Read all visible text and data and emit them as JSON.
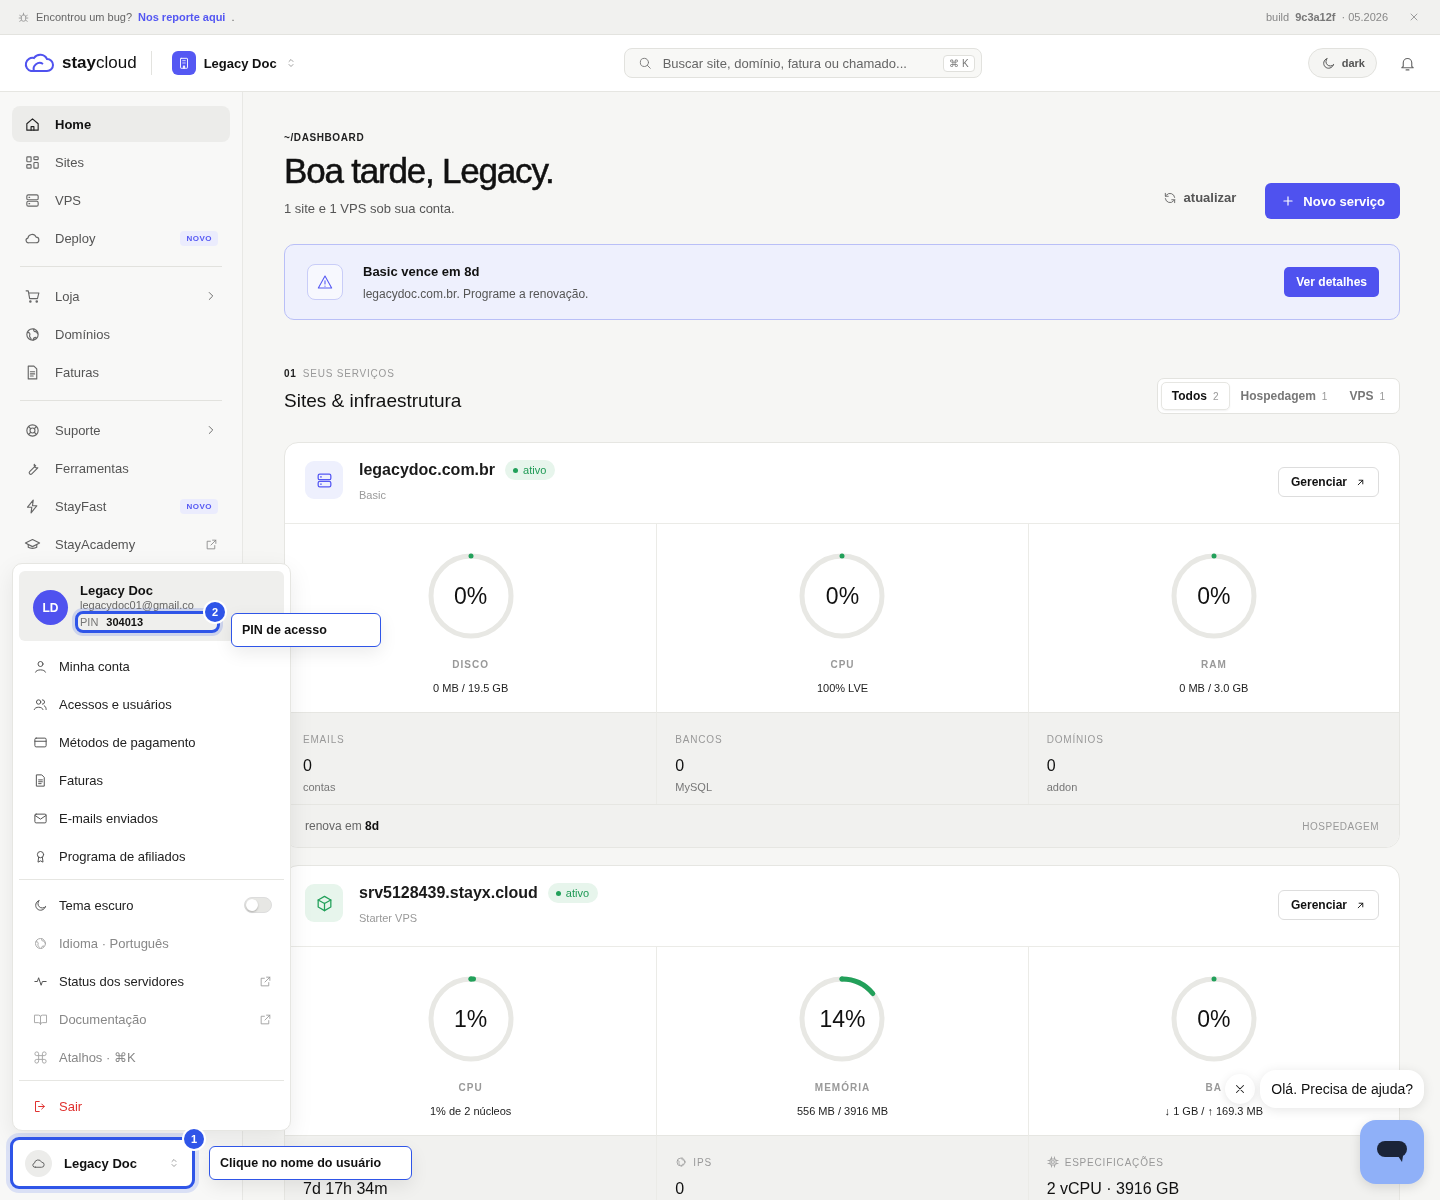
{
  "bug_bar": {
    "text": "Encontrou um bug?",
    "link": "Nos reporte aqui",
    "suffix": ".",
    "build_label": "build",
    "build_hash": "9c3a12f",
    "build_date": "· 05.2026"
  },
  "header": {
    "brand": "**stay**cloud",
    "workspace": "Legacy Doc",
    "search_placeholder": "Buscar site, domínio, fatura ou chamado...",
    "shortcut": "⌘ K",
    "theme_button": "dark"
  },
  "sidebar": {
    "groups": [
      [
        {
          "label": "Home",
          "selected": true,
          "kind": "link"
        },
        {
          "label": "Sites",
          "selected": false,
          "kind": "link"
        },
        {
          "label": "VPS",
          "selected": false,
          "kind": "link"
        },
        {
          "label": "Deploy",
          "selected": false,
          "kind": "link",
          "badge": "NOVO"
        }
      ],
      [
        {
          "label": "Loja",
          "selected": false,
          "kind": "submenu"
        },
        {
          "label": "Domínios",
          "selected": false,
          "kind": "link"
        },
        {
          "label": "Faturas",
          "selected": false,
          "kind": "link"
        }
      ],
      [
        {
          "label": "Suporte",
          "selected": false,
          "kind": "submenu"
        },
        {
          "label": "Ferramentas",
          "selected": false,
          "kind": "link"
        },
        {
          "label": "StayFast",
          "selected": false,
          "kind": "link",
          "badge": "NOVO"
        },
        {
          "label": "StayAcademy",
          "selected": false,
          "kind": "external"
        }
      ]
    ]
  },
  "page": {
    "breadcrumb": "~/DASHBOARD",
    "title": "Boa tarde, Legacy.",
    "subtitle": "1 site e 1 VPS sob sua conta.",
    "refresh": "atualizar",
    "new_button": "Novo serviço"
  },
  "alert": {
    "title": "Basic vence em 8d",
    "text": "legacydoc.com.br. Programe a renovação.",
    "button": "Ver detalhes"
  },
  "section": {
    "number": "01",
    "eyebrow": "SEUS SERVIÇOS",
    "title": "Sites & infraestrutura",
    "filters": [
      {
        "label": "Todos",
        "count": "2",
        "selected": true
      },
      {
        "label": "Hospedagem",
        "count": "1",
        "selected": false
      },
      {
        "label": "VPS",
        "count": "1",
        "selected": false
      }
    ]
  },
  "services": [
    {
      "kind": "hosting",
      "name": "legacydoc.com.br",
      "status": "ativo",
      "plan": "Basic",
      "manage": "Gerenciar",
      "gauges": [
        {
          "value": "0%",
          "label": "DISCO",
          "detail": "0 MB / 19.5 GB"
        },
        {
          "value": "0%",
          "label": "CPU",
          "detail": "100% LVE"
        },
        {
          "value": "0%",
          "label": "RAM",
          "detail": "0 MB / 3.0 GB"
        }
      ],
      "stats": [
        {
          "kind": "plain",
          "label": "EMAILS",
          "value": "0",
          "unit": "contas"
        },
        {
          "kind": "plain",
          "label": "BANCOS",
          "value": "0",
          "unit": "MySQL"
        },
        {
          "kind": "plain",
          "label": "DOMÍNIOS",
          "value": "0",
          "unit": "addon"
        }
      ],
      "footer": {
        "renew": "renova em **8d**",
        "type": "HOSPEDAGEM"
      }
    },
    {
      "kind": "vps",
      "name": "srv5128439.stayx.cloud",
      "status": "ativo",
      "plan": "Starter VPS",
      "manage": "Gerenciar",
      "gauges": [
        {
          "value": "1%",
          "label": "CPU",
          "detail": "1% de 2 núcleos"
        },
        {
          "value": "14%",
          "label": "MEMÓRIA",
          "detail": "556 MB / 3916 MB"
        },
        {
          "value": "0%",
          "label": "BA",
          "detail": "↓ 1 GB / ↑ 169.3 MB"
        }
      ],
      "stats": [
        {
          "kind": "plain",
          "value": "7d 17h 34m"
        },
        {
          "kind": "network",
          "label": "IPS",
          "value": "0"
        },
        {
          "kind": "chip",
          "label": "ESPECIFICAÇÕES",
          "value": "2 vCPU · 3916 GB"
        }
      ]
    }
  ],
  "user_menu": {
    "name": "Legacy Doc",
    "initials": "LD",
    "email": "legacydoc01@gmail.co",
    "pin_label": "PIN",
    "pin": "304013",
    "groups": [
      [
        {
          "label": "Minha conta",
          "kind": "link",
          "muted": false
        },
        {
          "label": "Acessos e usuários",
          "kind": "link",
          "muted": false
        },
        {
          "label": "Métodos de pagamento",
          "kind": "link",
          "muted": false
        },
        {
          "label": "Faturas",
          "kind": "link",
          "muted": false
        },
        {
          "label": "E-mails enviados",
          "kind": "link",
          "muted": false
        },
        {
          "label": "Programa de afiliados",
          "kind": "link",
          "muted": false
        }
      ],
      [
        {
          "label": "Tema escuro",
          "kind": "toggle",
          "on": false,
          "muted": false
        },
        {
          "label": "Idioma · Português",
          "kind": "link",
          "muted": true
        },
        {
          "label": "Status dos servidores",
          "kind": "external",
          "muted": false
        },
        {
          "label": "Documentação",
          "kind": "external",
          "muted": true
        },
        {
          "label": "Atalhos · ⌘K",
          "kind": "link",
          "muted": true
        }
      ],
      [
        {
          "label": "Sair",
          "kind": "danger"
        }
      ]
    ]
  },
  "user_button": {
    "name": "Legacy Doc"
  },
  "tour": [
    {
      "number": "2",
      "text": "PIN de acesso"
    },
    {
      "number": "1",
      "text": "Clique no nome do usuário"
    }
  ],
  "chat": {
    "greeting": "Olá. Precisa de ajuda?"
  }
}
